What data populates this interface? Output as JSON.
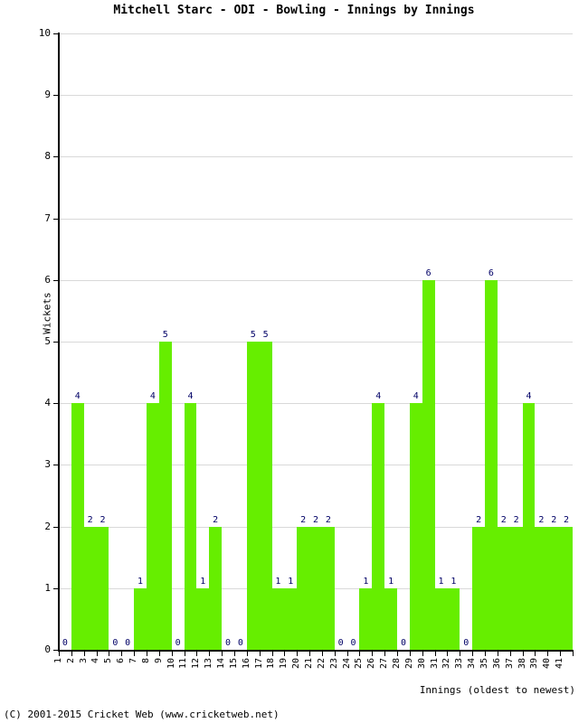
{
  "chart_data": {
    "type": "bar",
    "title": "Mitchell Starc - ODI - Bowling - Innings by Innings",
    "xlabel": "Innings (oldest to newest)",
    "ylabel": "Wickets",
    "ylim": [
      0,
      10
    ],
    "ytick_labels": [
      "0",
      "1",
      "2",
      "3",
      "4",
      "5",
      "6",
      "7",
      "8",
      "9",
      "10"
    ],
    "ytick_values": [
      0,
      1,
      2,
      3,
      4,
      5,
      6,
      7,
      8,
      9,
      10
    ],
    "grid": true,
    "legend": "none",
    "bar_color": "#66ee00",
    "label_color": "#000066",
    "categories": [
      "1",
      "2",
      "3",
      "4",
      "5",
      "6",
      "7",
      "8",
      "9",
      "10",
      "11",
      "12",
      "13",
      "14",
      "15",
      "16",
      "17",
      "18",
      "19",
      "20",
      "21",
      "22",
      "23",
      "24",
      "25",
      "26",
      "27",
      "28",
      "29",
      "30",
      "31",
      "32",
      "33",
      "34",
      "35",
      "36",
      "37",
      "38",
      "39",
      "40",
      "41"
    ],
    "values": [
      0,
      4,
      2,
      2,
      0,
      0,
      1,
      4,
      5,
      0,
      4,
      1,
      2,
      0,
      0,
      5,
      5,
      1,
      1,
      2,
      2,
      2,
      0,
      0,
      1,
      4,
      1,
      0,
      4,
      6,
      1,
      1,
      0,
      2,
      6,
      2,
      2,
      4,
      2,
      2,
      2
    ],
    "value_labels": [
      "0",
      "4",
      "2",
      "2",
      "0",
      "0",
      "1",
      "4",
      "5",
      "0",
      "4",
      "1",
      "2",
      "0",
      "0",
      "5",
      "5",
      "1",
      "1",
      "2",
      "2",
      "2",
      "0",
      "0",
      "1",
      "4",
      "1",
      "0",
      "4",
      "6",
      "1",
      "1",
      "0",
      "2",
      "6",
      "2",
      "2",
      "4",
      "2",
      "2",
      "2"
    ]
  },
  "footer": {
    "copyright": "(C) 2001-2015 Cricket Web (www.cricketweb.net)"
  }
}
